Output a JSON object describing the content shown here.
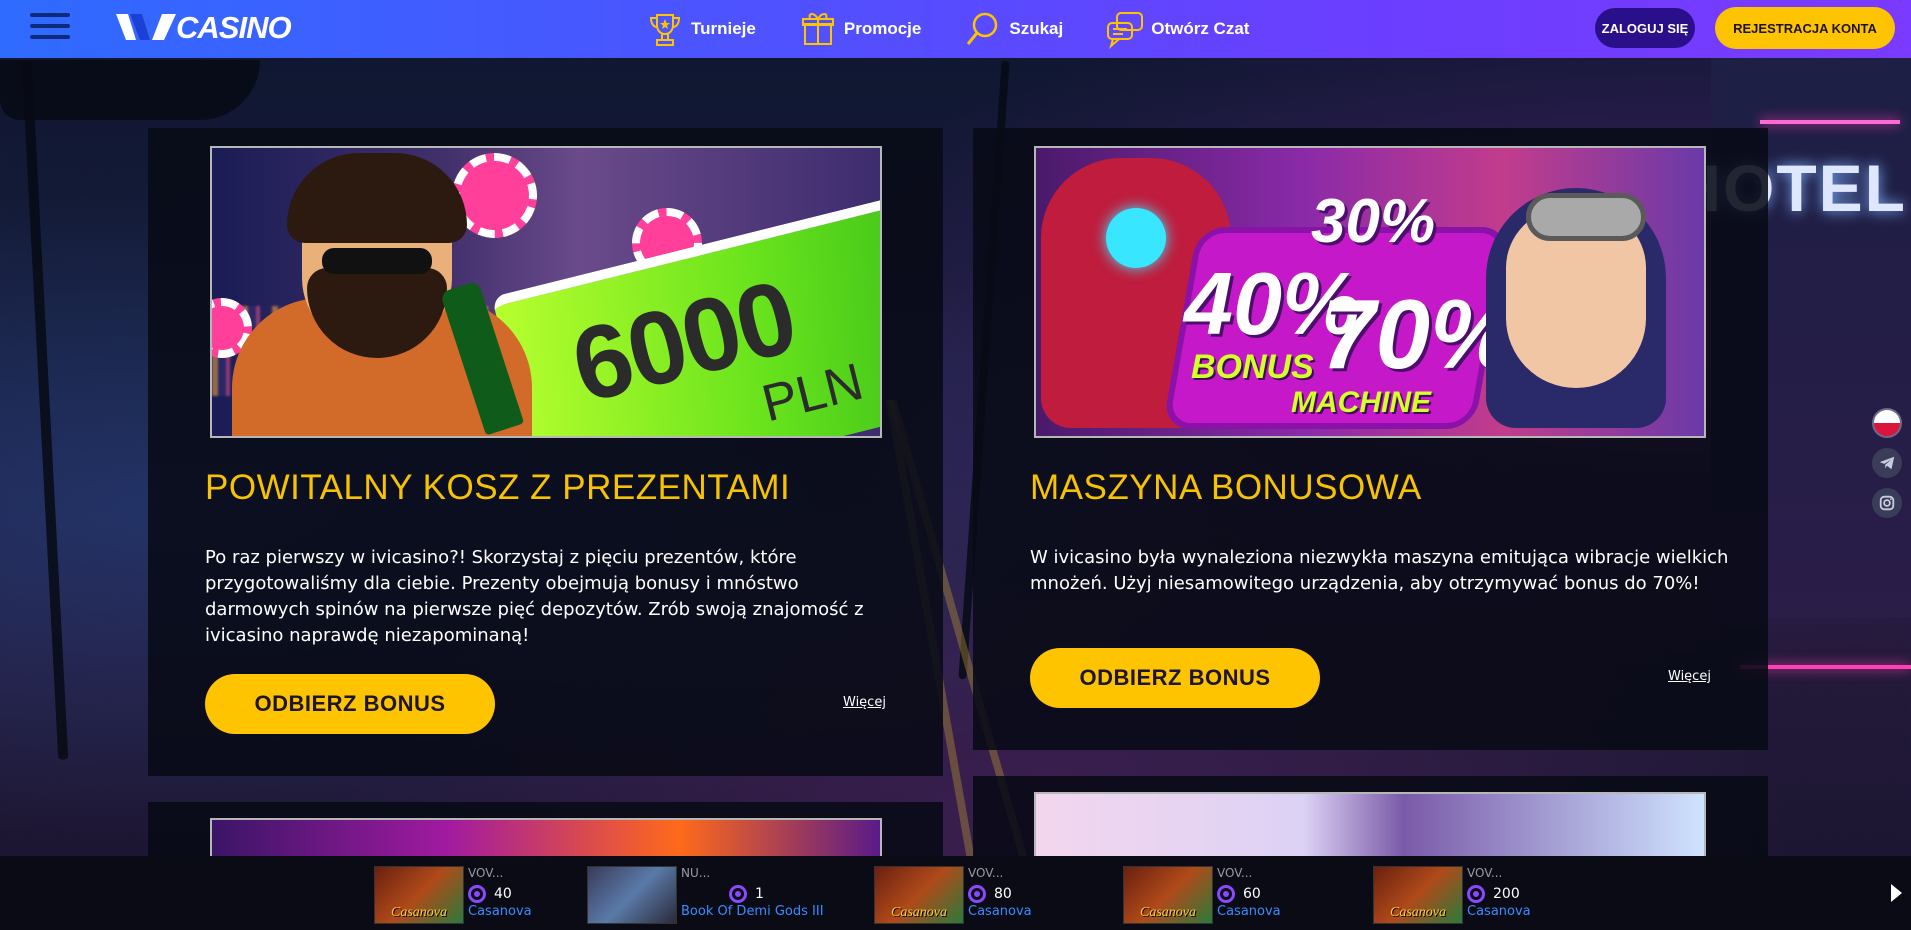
{
  "header": {
    "logo_text": "CASINO",
    "nav": [
      {
        "label": "Turnieje",
        "icon": "trophy-icon"
      },
      {
        "label": "Promocje",
        "icon": "gift-icon"
      },
      {
        "label": "Szukaj",
        "icon": "search-icon"
      },
      {
        "label": "Otwórz Czat",
        "icon": "chat-icon"
      }
    ],
    "login_label": "ZALOGUJ SIĘ",
    "register_label": "REJESTRACJA KONTA"
  },
  "background": {
    "hotel_sign": "HOTEL"
  },
  "promos": [
    {
      "banner_amount": "6000",
      "banner_currency": "PLN",
      "title": "POWITALNY KOSZ Z PREZENTAMI",
      "description": "Po raz pierwszy w ivicasino?! Skorzystaj z pięciu prezentów, które przygotowaliśmy dla ciebie. Prezenty obejmują bonusy i mnóstwo darmowych spinów na pierwsze pięć depozytów. Zrób swoją znajomość z ivicasino naprawdę niezapominaną!",
      "button_label": "ODBIERZ BONUS",
      "more_label": "Więcej"
    },
    {
      "banner_pct_1": "30%",
      "banner_pct_2": "40%",
      "banner_pct_3": "70%",
      "banner_word_1": "BONUS",
      "banner_word_2": "MACHINE",
      "title": "MASZYNA BONUSOWA",
      "description": "W ivicasino była wynaleziona niezwykła maszyna emitująca wibracje wielkich mnożeń. Użyj niesamowitego urządzenia, aby otrzymywać bonus do 70%!",
      "button_label": "ODBIERZ BONUS",
      "more_label": "Więcej"
    }
  ],
  "side_icons": [
    "poland-flag-icon",
    "telegram-icon",
    "instagram-icon"
  ],
  "winners": [
    {
      "user": "VOV...",
      "amount": "40",
      "game": "Casanova",
      "thumb_text": "Casanova"
    },
    {
      "user": "NU...",
      "amount": "1",
      "game": "Book Of Demi Gods III",
      "thumb_text": ""
    },
    {
      "user": "VOV...",
      "amount": "80",
      "game": "Casanova",
      "thumb_text": "Casanova"
    },
    {
      "user": "VOV...",
      "amount": "60",
      "game": "Casanova",
      "thumb_text": "Casanova"
    },
    {
      "user": "VOV...",
      "amount": "200",
      "game": "Casanova",
      "thumb_text": "Casanova"
    }
  ],
  "colors": {
    "accent_yellow": "#ffc400",
    "title_yellow": "#f7c300",
    "header_blue": "#2f6bff",
    "header_purple": "#7a3aff",
    "login_bg": "#2a0f8a",
    "game_link": "#3a8cff"
  }
}
